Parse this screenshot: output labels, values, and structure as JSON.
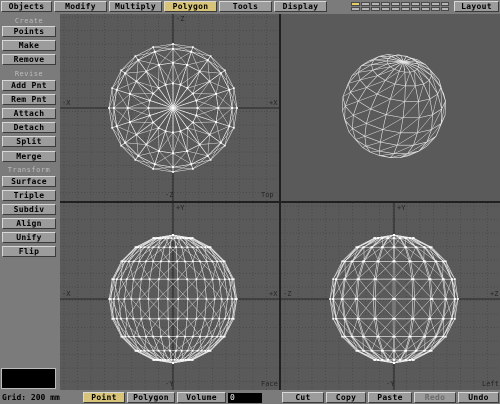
{
  "top_menu": [
    {
      "label": "Objects",
      "active": false
    },
    {
      "label": "Modify",
      "active": false
    },
    {
      "label": "Multiply",
      "active": false
    },
    {
      "label": "Polygon",
      "active": true
    },
    {
      "label": "Tools",
      "active": false
    },
    {
      "label": "Display",
      "active": false
    }
  ],
  "layout_label": "Layout",
  "sections": {
    "create": "Create",
    "revise": "Revise",
    "transform": "Transform"
  },
  "left_buttons": {
    "points": "Points",
    "make": "Make",
    "remove": "Remove",
    "add_pnt": "Add Pnt",
    "rem_pnt": "Rem Pnt",
    "attach": "Attach",
    "detach": "Detach",
    "split": "Split",
    "merge": "Merge",
    "surface": "Surface",
    "triple": "Triple",
    "subdiv": "Subdiv",
    "align": "Align",
    "unify": "Unify",
    "flip": "Flip"
  },
  "viewports": {
    "top": {
      "label": "Top",
      "axes": {
        "up": "-Z",
        "down": "-Z",
        "left": "-X",
        "right": "+X"
      }
    },
    "face": {
      "label": "Face",
      "axes": {
        "up": "+Y",
        "down": "-Y",
        "left": "-X",
        "right": "+X"
      }
    },
    "left": {
      "label": "Left",
      "axes": {
        "up": "+Y",
        "down": "-Y",
        "left": "-Z",
        "right": "+Z"
      }
    }
  },
  "bottom": {
    "grid": "Grid: 200 mm",
    "modes": [
      {
        "label": "Point",
        "active": true
      },
      {
        "label": "Polygon",
        "active": false
      },
      {
        "label": "Volume",
        "active": false
      }
    ],
    "volume_value": "0",
    "actions": [
      {
        "label": "Cut",
        "enabled": true
      },
      {
        "label": "Copy",
        "enabled": true
      },
      {
        "label": "Paste",
        "enabled": true
      },
      {
        "label": "Redo",
        "enabled": false
      },
      {
        "label": "Undo",
        "enabled": true
      }
    ]
  },
  "colors": {
    "active_tab": "#d8c478",
    "viewport_bg": "#5a5a5a",
    "wire": "#e6e6e6"
  }
}
